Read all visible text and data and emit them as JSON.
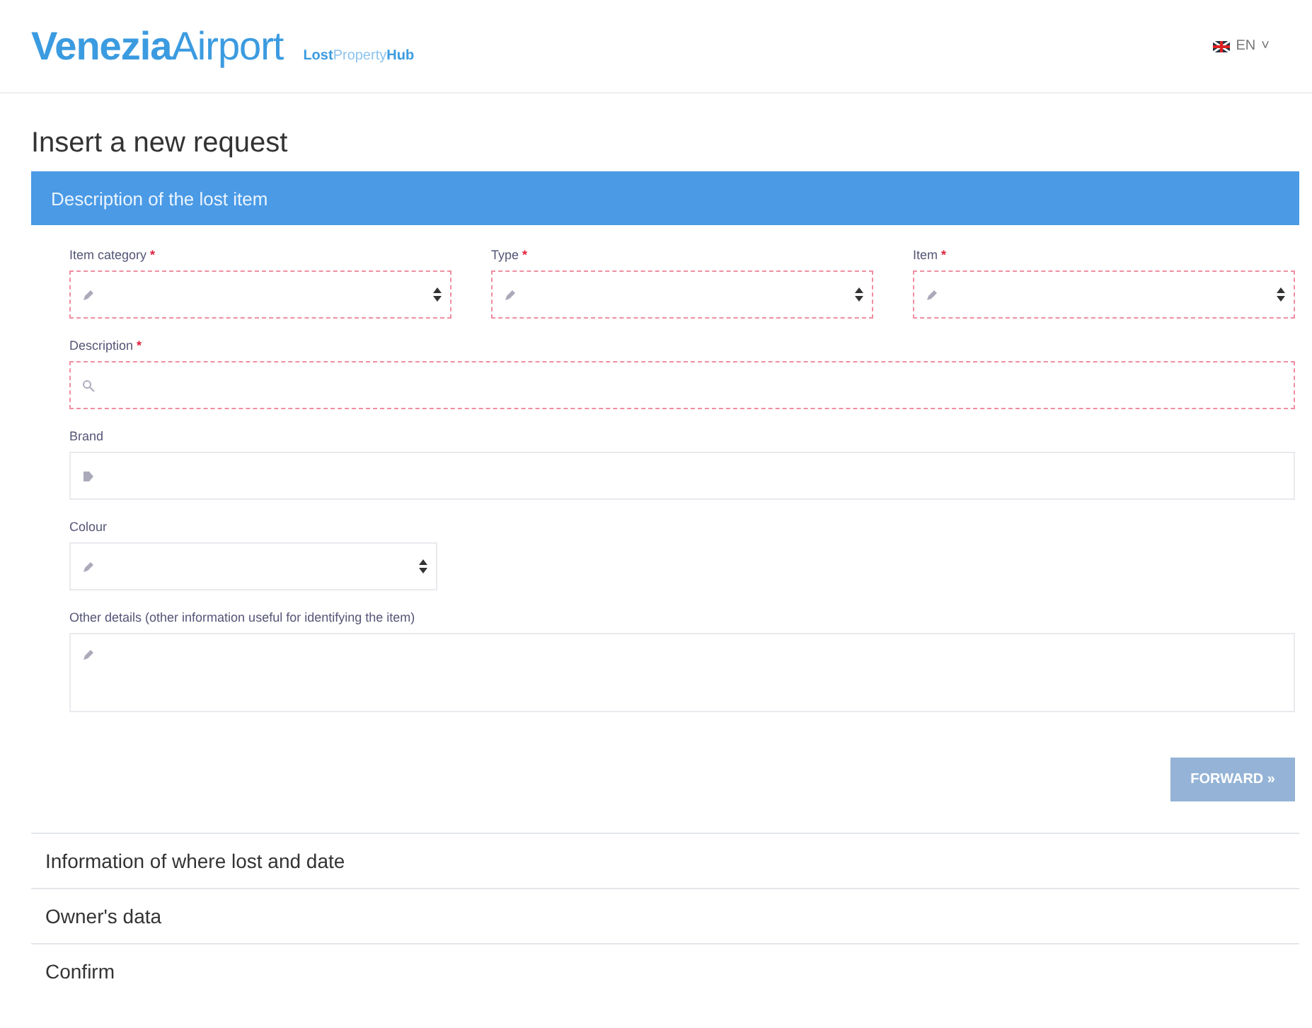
{
  "header": {
    "brand_bold": "Venezia",
    "brand_light": "Airport",
    "subtitle_parts": [
      "Lost",
      "Property",
      "Hub"
    ],
    "language": "EN",
    "language_caret": "˅"
  },
  "page_title": "Insert a new request",
  "sections": [
    {
      "title": "Description of the lost item",
      "expanded": true
    },
    {
      "title": "Information of where lost and date",
      "expanded": false
    },
    {
      "title": "Owner's data",
      "expanded": false
    },
    {
      "title": "Confirm",
      "expanded": false
    }
  ],
  "form": {
    "rows": [
      [
        {
          "label": "Item category",
          "marker": "*",
          "kind": "select",
          "invalid": true
        },
        {
          "label": "Type",
          "marker": "*",
          "kind": "select",
          "invalid": true
        },
        {
          "label": "Item",
          "marker": "*",
          "kind": "select",
          "invalid": true
        }
      ],
      [
        {
          "label": "Description",
          "marker": "*",
          "kind": "text",
          "invalid": true
        }
      ],
      [
        {
          "label": "Brand",
          "kind": "text",
          "invalid": false
        }
      ],
      [
        {
          "label": "Colour",
          "kind": "select",
          "invalid": false
        }
      ],
      [
        {
          "label": "Other details (other information useful for identifying the item)",
          "kind": "textarea",
          "invalid": false
        }
      ]
    ],
    "button": {
      "label": "FORWARD »",
      "disabled": true
    }
  }
}
